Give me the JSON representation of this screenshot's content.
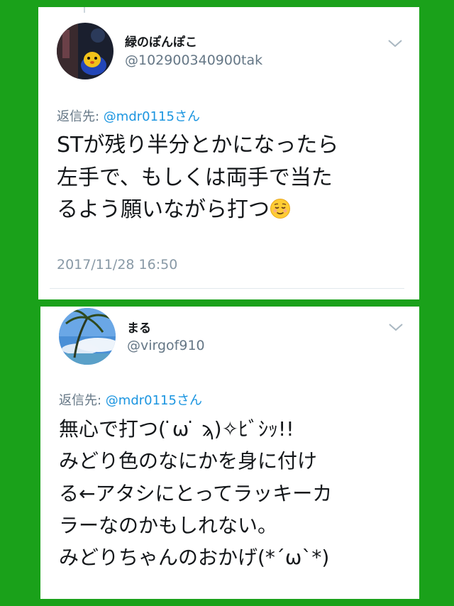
{
  "tweets": [
    {
      "display_name": "緑のぽんぽこ",
      "handle": "@102900340900tak",
      "reply_prefix": "返信先: ",
      "reply_mention": "@mdr0115さん",
      "lines": [
        "STが残り半分とかになったら",
        "左手で、もしくは両手で当た",
        "るよう願いながら打つ"
      ],
      "emoji": "relieved-face-emoji",
      "timestamp": "2017/11/28 16:50"
    },
    {
      "display_name": "まる",
      "handle": "@virgof910",
      "reply_prefix": "返信先: ",
      "reply_mention": "@mdr0115さん",
      "lines": [
        "無心で打つ( ̇ω ̇ ϡ)✧ﾋﾞｼｯ!!",
        "みどり色のなにかを身に付け",
        "る←アタシにとってラッキーカ",
        "ラーなのかもしれない。",
        "みどりちゃんのおかげ(*´ω`*)"
      ]
    }
  ],
  "colors": {
    "background": "#1aa11a",
    "card": "#ffffff",
    "text": "#14171a",
    "secondary": "#657786",
    "link": "#1b95e0"
  },
  "icons": {
    "more": "chevron-down-icon",
    "avatar1": "mascot-avatar",
    "avatar2": "palm-tree-beach-avatar"
  }
}
